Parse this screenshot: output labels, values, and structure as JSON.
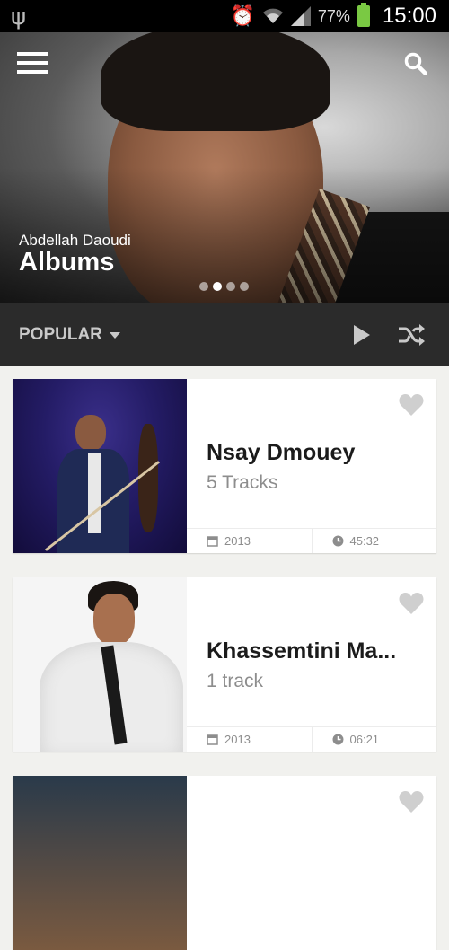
{
  "status_bar": {
    "battery_percent": "77%",
    "time": "15:00"
  },
  "hero": {
    "artist": "Abdellah Daoudi",
    "title": "Albums",
    "page_indicator": {
      "pages": 4,
      "active": 2
    }
  },
  "filter_bar": {
    "sort_label": "POPULAR"
  },
  "albums": [
    {
      "name": "Nsay Dmouey",
      "tracks": "5 Tracks",
      "year": "2013",
      "duration": "45:32"
    },
    {
      "name": "Khassemtini Ma...",
      "tracks": "1 track",
      "year": "2013",
      "duration": "06:21"
    }
  ],
  "colors": {
    "toolbar_bg": "#2b2b2b",
    "list_bg": "#f1f1ee",
    "card_bg": "#ffffff",
    "secondary_text": "#8d8d8d",
    "battery": "#7ac943"
  },
  "icons": [
    "usb-icon",
    "alarm-icon",
    "wifi-icon",
    "signal-icon",
    "battery-icon",
    "menu-icon",
    "search-icon",
    "caret-down-icon",
    "play-icon",
    "shuffle-icon",
    "heart-icon",
    "calendar-icon",
    "clock-icon"
  ]
}
